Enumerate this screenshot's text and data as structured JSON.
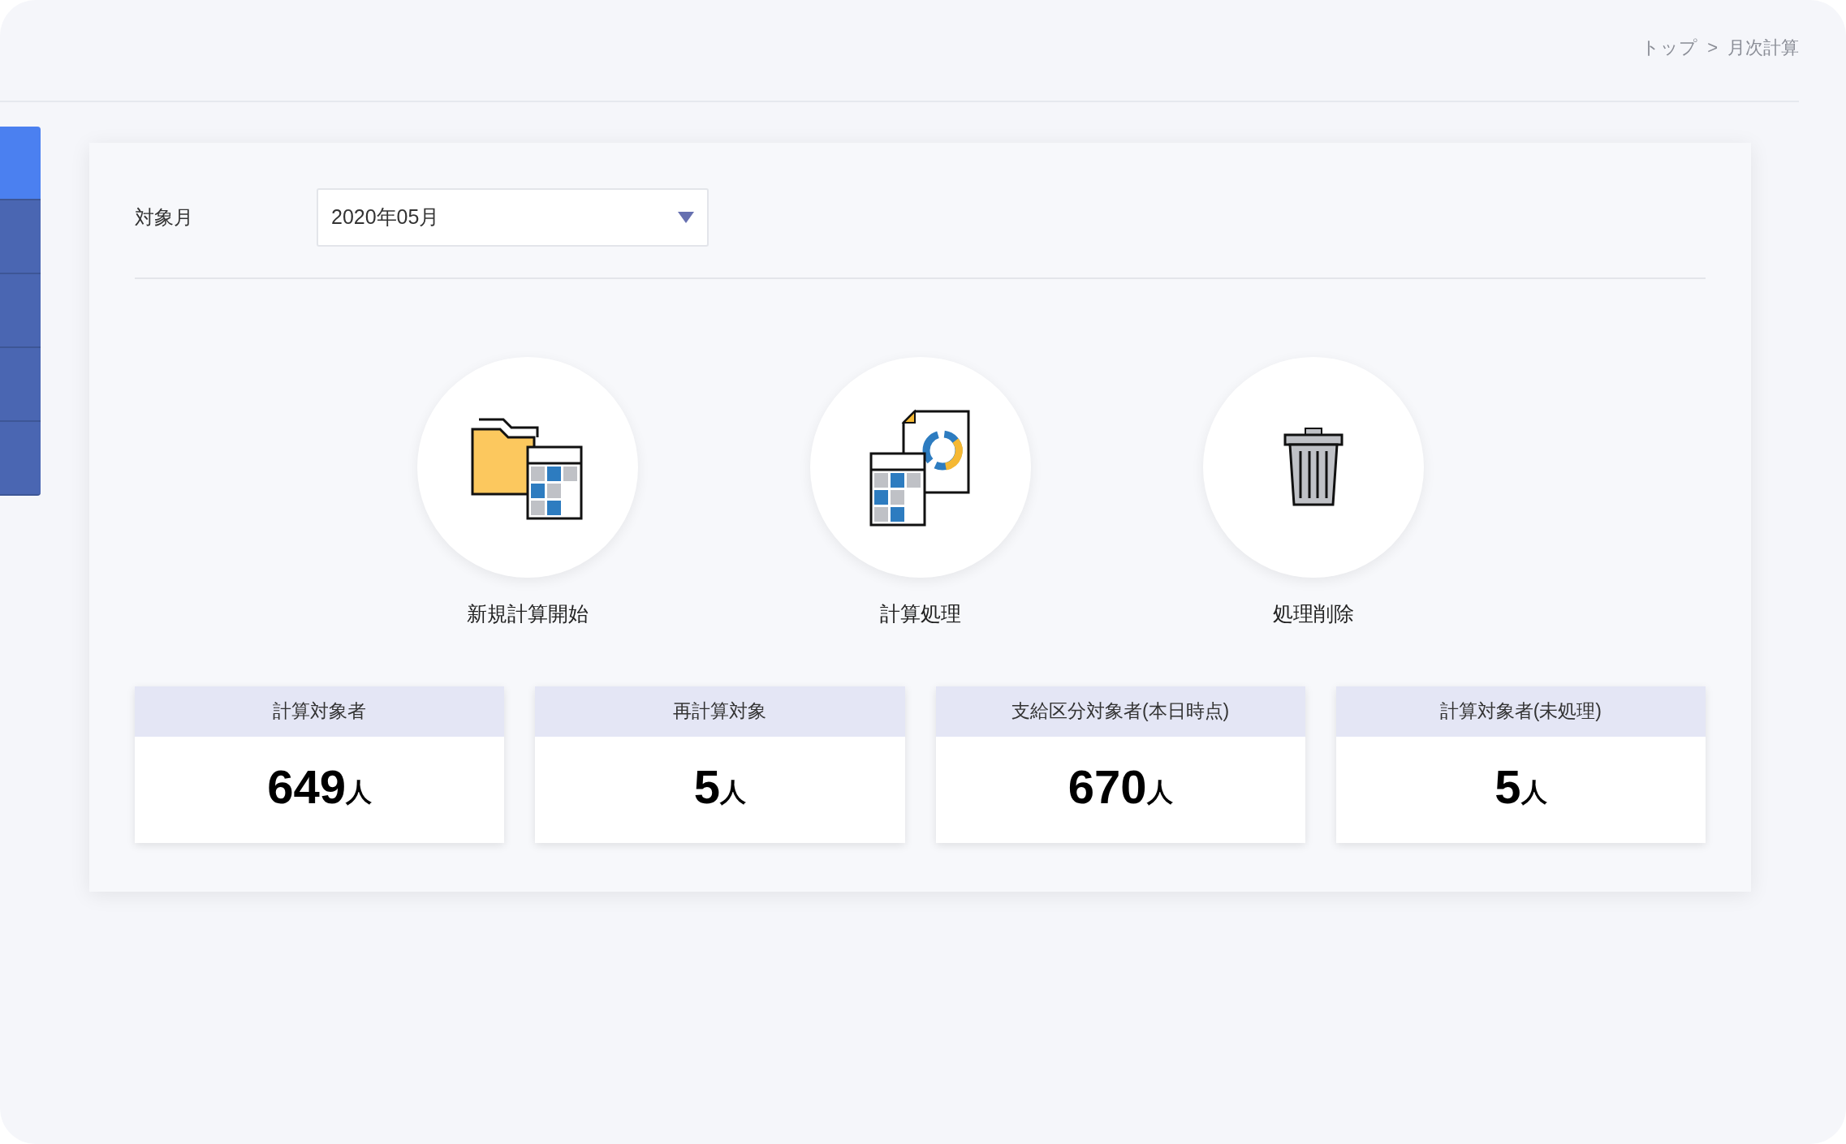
{
  "breadcrumb": [
    {
      "label": "トップ"
    },
    {
      "label": ">"
    },
    {
      "label": "月次計算"
    }
  ],
  "sidebar": {
    "items": [
      {
        "selected": true
      },
      {
        "selected": false
      },
      {
        "selected": false
      },
      {
        "selected": false
      },
      {
        "selected": false
      }
    ]
  },
  "month_field": {
    "label": "対象月",
    "value": "2020年05月"
  },
  "actions": [
    {
      "kind": "new",
      "label": "新規計算開始"
    },
    {
      "kind": "process",
      "label": "計算処理"
    },
    {
      "kind": "delete",
      "label": "処理削除"
    }
  ],
  "stats": [
    {
      "title": "計算対象者",
      "value": "649",
      "unit": "人"
    },
    {
      "title": "再計算対象",
      "value": "5",
      "unit": "人"
    },
    {
      "title": "支給区分対象者(本日時点)",
      "value": "670",
      "unit": "人"
    },
    {
      "title": "計算対象者(未処理)",
      "value": "5",
      "unit": "人"
    }
  ]
}
